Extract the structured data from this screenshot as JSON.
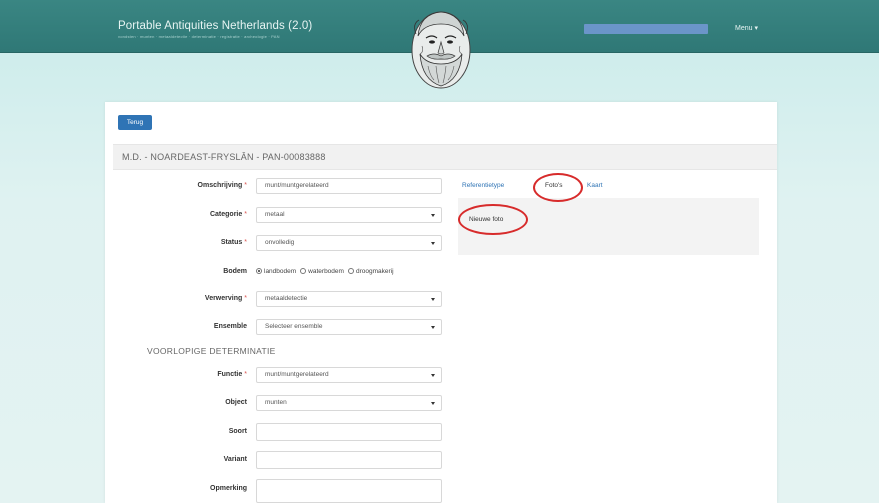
{
  "header": {
    "brand": "Portable Antiquities Netherlands (2.0)",
    "brand_sub": "vondsten · munten · metaaldetectie · determinatie · registratie · archeologie · PAN",
    "menu_label": "Menu ▾",
    "logo_icon": "bearded-face-logo-icon",
    "user_bar_color": "#6b95c9"
  },
  "actions": {
    "back_label": "Terug"
  },
  "record": {
    "title": "M.D. - NOARDEAST-FRYSLÂN - PAN-00083888"
  },
  "form": {
    "omschrijving": {
      "label": "Omschrijving",
      "value": "munt/muntgerelateerd"
    },
    "categorie": {
      "label": "Categorie",
      "value": "metaal"
    },
    "status": {
      "label": "Status",
      "value": "onvolledig"
    },
    "bodem": {
      "label": "Bodem",
      "options": [
        "landbodem",
        "waterbodem",
        "droogmakerij"
      ],
      "selected": "landbodem"
    },
    "verwerving": {
      "label": "Verwerving",
      "value": "metaaldetectie"
    },
    "ensemble": {
      "label": "Ensemble",
      "value": "Selecteer ensemble"
    },
    "section_title": "VOORLOPIGE DETERMINATIE",
    "functie": {
      "label": "Functie",
      "value": "munt/muntgerelateerd"
    },
    "object": {
      "label": "Object",
      "value": "munten"
    },
    "soort": {
      "label": "Soort",
      "value": ""
    },
    "variant": {
      "label": "Variant",
      "value": ""
    },
    "opmerking": {
      "label": "Opmerking",
      "value": ""
    },
    "required_mark": "*"
  },
  "tabs": {
    "items": [
      "Referentietype",
      "Foto's",
      "Kaart"
    ],
    "active": "Foto's",
    "new_photo_label": "Nieuwe foto"
  },
  "colors": {
    "accent": "#2f74b5",
    "header": "#3a8683",
    "highlight_ring": "#d72b2b"
  }
}
